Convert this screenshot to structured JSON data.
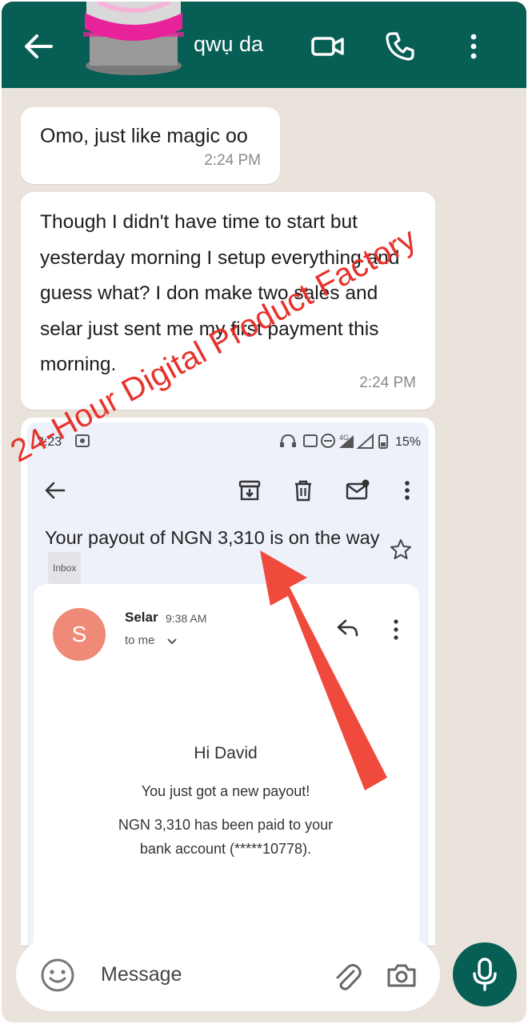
{
  "header": {
    "contact_name": "qwụ da",
    "icons": [
      "back-arrow-icon",
      "cake-avatar",
      "video-call-icon",
      "phone-icon",
      "more-vert-icon"
    ]
  },
  "messages": [
    {
      "text": "Omo, just like magic oo",
      "time": "2:24 PM"
    },
    {
      "text": "Though I didn't have time to start but yesterday morning I setup everything and guess what? I don make two sales and selar just sent me my first payment this morning.",
      "time": "2:24 PM"
    }
  ],
  "screenshot": {
    "status_time": "2:23",
    "battery": "15%",
    "network": "4G",
    "subject": "Your payout of NGN 3,310 is on the way",
    "label": "Inbox",
    "sender_initial": "S",
    "sender": "Selar",
    "sent_time": "9:38 AM",
    "to": "to me",
    "greeting": "Hi David",
    "line1": "You just got a new payout!",
    "line2": "NGN 3,310 has been paid to your bank account (*****10778)."
  },
  "input": {
    "placeholder": "Message"
  },
  "watermark": {
    "text": "24-Hour Digital Product Factory",
    "color": "#e8322c"
  },
  "colors": {
    "header": "#075e54",
    "chat_bg": "#e9e3dc",
    "arrow": "#ef4a3c",
    "avatar": "#ef8a78"
  }
}
